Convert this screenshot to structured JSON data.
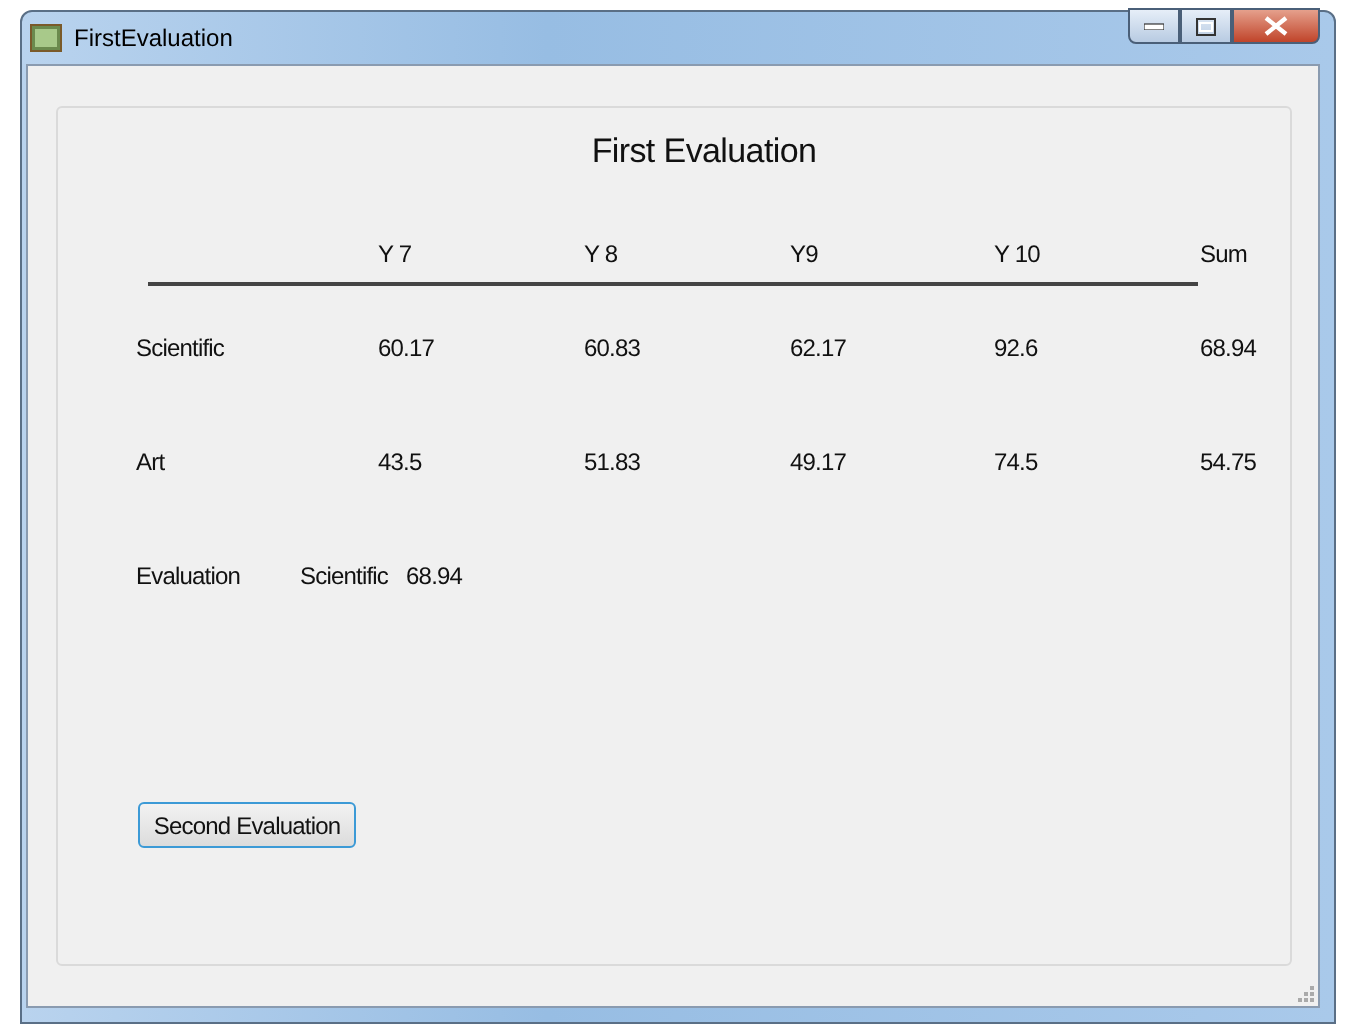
{
  "window": {
    "title": "FirstEvaluation"
  },
  "heading": "First Evaluation",
  "table": {
    "columns": [
      "Y 7",
      "Y 8",
      "Y9",
      "Y 10",
      "Sum"
    ],
    "rows": [
      {
        "label": "Scientific",
        "cells": [
          "60.17",
          "60.83",
          "62.17",
          "92.6",
          "68.94"
        ]
      },
      {
        "label": "Art",
        "cells": [
          "43.5",
          "51.83",
          "49.17",
          "74.5",
          "54.75"
        ]
      }
    ]
  },
  "evaluation": {
    "label": "Evaluation",
    "category": "Scientific",
    "score": "68.94"
  },
  "buttons": [
    "Second Evaluation"
  ]
}
